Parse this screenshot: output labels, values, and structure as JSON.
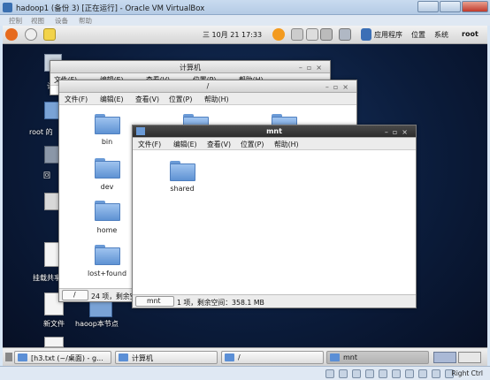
{
  "vbox": {
    "title": "hadoop1 (备份 3) [正在运行] - Oracle VM VirtualBox",
    "menu": [
      "控制",
      "视图",
      "设备",
      "帮助"
    ]
  },
  "guest_panel": {
    "clock": "三 10月 21 17:33",
    "menus": [
      "应用程序",
      "位置",
      "系统"
    ],
    "user": "root"
  },
  "desktop": {
    "icons": [
      {
        "label": "计"
      },
      {
        "label": "root 的"
      },
      {
        "label": "回"
      },
      {
        "label": "挂载共享"
      },
      {
        "label": "新文件"
      },
      {
        "label": "haoop本节点"
      }
    ]
  },
  "win_computer": {
    "title": "计算机",
    "menu": [
      "文件(F)",
      "编辑(E)",
      "查看(V)",
      "位置(P)",
      "帮助(H)"
    ]
  },
  "win_root": {
    "title": "/",
    "menu": [
      "文件(F)",
      "编辑(E)",
      "查看(V)",
      "位置(P)",
      "帮助(H)"
    ],
    "folders": [
      "bin",
      "dev",
      "home",
      "lost+found"
    ],
    "path": "/",
    "status": "24 项，剩余空"
  },
  "win_mnt": {
    "title": "mnt",
    "menu": [
      "文件(F)",
      "编辑(E)",
      "查看(V)",
      "位置(P)",
      "帮助(H)"
    ],
    "folders": [
      "shared"
    ],
    "path": "mnt",
    "status": "1 项，剩余空间：358.1 MB"
  },
  "taskbar": {
    "items": [
      "[h3.txt (~/桌面) - g...",
      "计算机",
      "/",
      "mnt"
    ]
  },
  "host_status": {
    "hostkey": "Right Ctrl"
  },
  "colors": {
    "desktop_bg": "#0b1c3b",
    "folder": "#6a9ad6",
    "active_title": "#2c2c2c"
  }
}
